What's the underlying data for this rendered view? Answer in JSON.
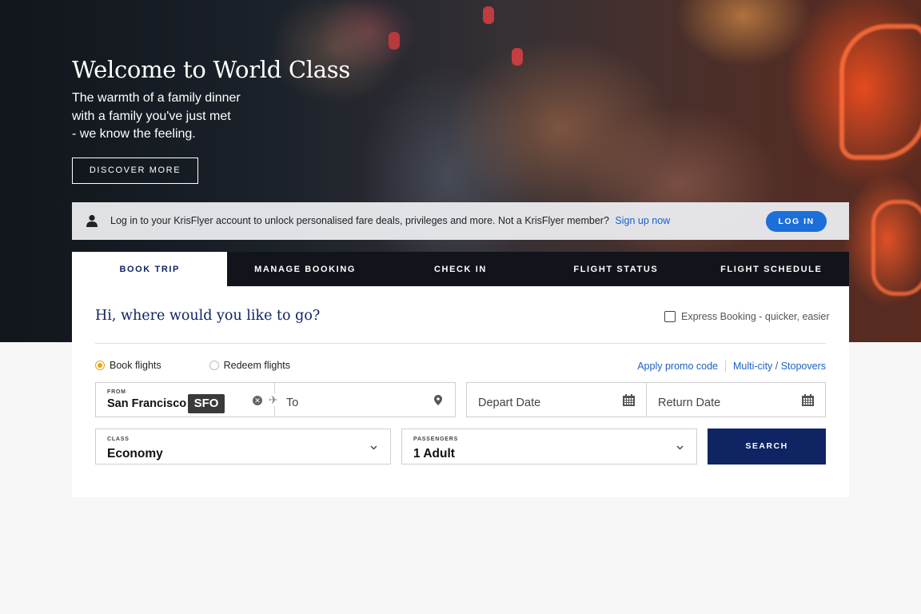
{
  "hero": {
    "title": "Welcome to World Class",
    "subtitle_lines": [
      "The warmth of a family dinner",
      "with a family you've just met",
      "- we know the feeling."
    ],
    "cta_label": "DISCOVER MORE"
  },
  "login_bar": {
    "message": "Log in to your KrisFlyer account to unlock personalised fare deals, privileges and more. Not a KrisFlyer member?",
    "signup_label": "Sign up now",
    "login_label": "LOG IN",
    "icon": "user-icon"
  },
  "tabs": [
    {
      "label": "BOOK TRIP",
      "active": true
    },
    {
      "label": "MANAGE BOOKING",
      "active": false
    },
    {
      "label": "CHECK IN",
      "active": false
    },
    {
      "label": "FLIGHT STATUS",
      "active": false
    },
    {
      "label": "FLIGHT SCHEDULE",
      "active": false
    }
  ],
  "booking": {
    "greeting": "Hi, where would you like to go?",
    "express_label": "Express Booking - quicker, easier",
    "express_checked": false,
    "trip_types": [
      {
        "label": "Book flights",
        "selected": true
      },
      {
        "label": "Redeem flights",
        "selected": false
      }
    ],
    "promo_label": "Apply promo code",
    "multicity_label": "Multi-city / Stopovers",
    "from": {
      "label": "FROM",
      "city": "San Francisco",
      "code": "SFO"
    },
    "to": {
      "placeholder": "To"
    },
    "depart": {
      "placeholder": "Depart Date"
    },
    "return": {
      "placeholder": "Return Date"
    },
    "class": {
      "label": "CLASS",
      "value": "Economy"
    },
    "passengers": {
      "label": "PASSENGERS",
      "value": "1 Adult"
    },
    "search_label": "SEARCH"
  },
  "colors": {
    "brand_navy": "#0f2463",
    "link_blue": "#1b5fc8",
    "login_button": "#1c6fd8",
    "radio_accent": "#f0a400"
  }
}
